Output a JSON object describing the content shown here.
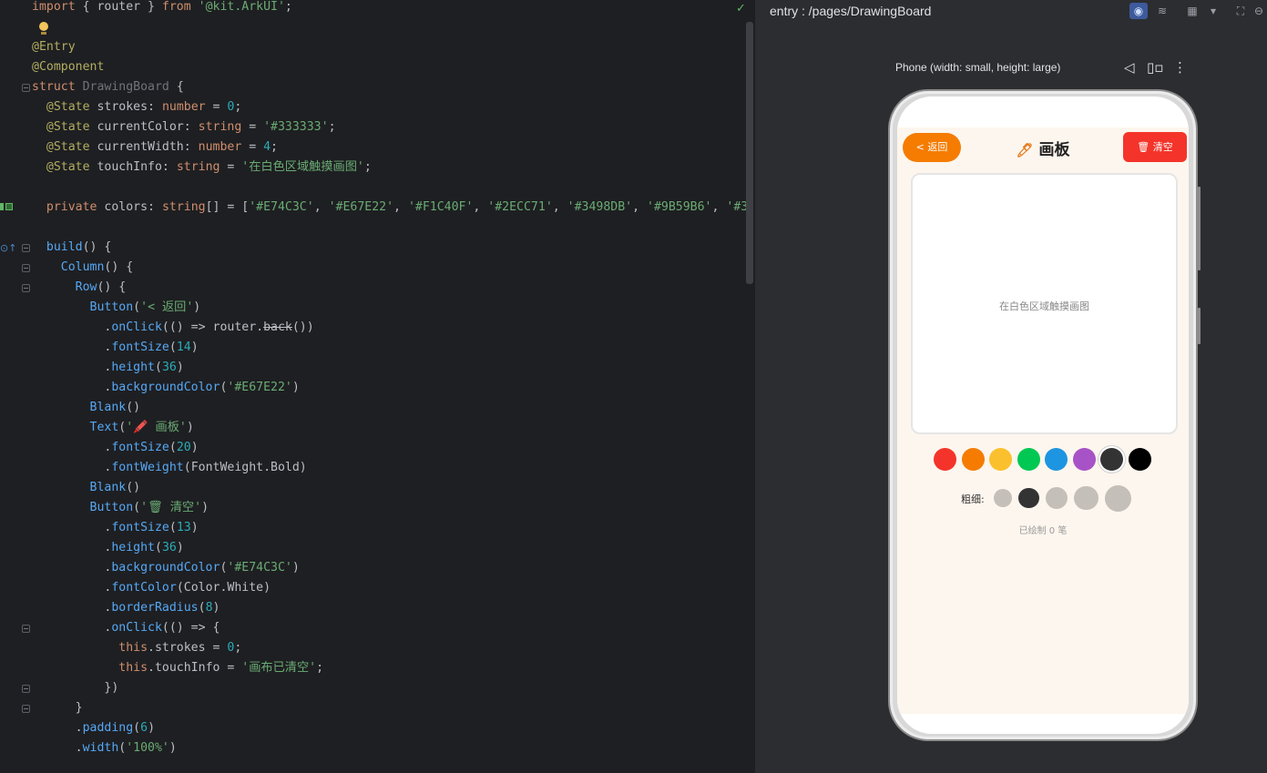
{
  "editor": {
    "status": "✓",
    "lines": [
      [
        [
          "kw",
          "import"
        ],
        [
          "",
          " { router } "
        ],
        [
          "kw",
          "from"
        ],
        [
          "",
          " "
        ],
        [
          "str",
          "'@kit.ArkUI'"
        ],
        [
          "",
          ";"
        ]
      ],
      [],
      [
        [
          "ann",
          "@Entry"
        ]
      ],
      [
        [
          "ann",
          "@Component"
        ]
      ],
      [
        [
          "kw",
          "struct"
        ],
        [
          "",
          " "
        ],
        [
          "dim",
          "DrawingBoard"
        ],
        [
          "",
          " {"
        ]
      ],
      [
        [
          "",
          "  "
        ],
        [
          "ann",
          "@State"
        ],
        [
          "",
          " strokes: "
        ],
        [
          "typ",
          "number"
        ],
        [
          "",
          " = "
        ],
        [
          "num",
          "0"
        ],
        [
          "",
          ";"
        ]
      ],
      [
        [
          "",
          "  "
        ],
        [
          "ann",
          "@State"
        ],
        [
          "",
          " currentColor: "
        ],
        [
          "typ",
          "string"
        ],
        [
          "",
          " = "
        ],
        [
          "str",
          "'#333333'"
        ],
        [
          "",
          ";"
        ]
      ],
      [
        [
          "",
          "  "
        ],
        [
          "ann",
          "@State"
        ],
        [
          "",
          " currentWidth: "
        ],
        [
          "typ",
          "number"
        ],
        [
          "",
          " = "
        ],
        [
          "num",
          "4"
        ],
        [
          "",
          ";"
        ]
      ],
      [
        [
          "",
          "  "
        ],
        [
          "ann",
          "@State"
        ],
        [
          "",
          " touchInfo: "
        ],
        [
          "typ",
          "string"
        ],
        [
          "",
          " = "
        ],
        [
          "str",
          "'在白色区域触摸画图'"
        ],
        [
          "",
          ";"
        ]
      ],
      [],
      [
        [
          "",
          "  "
        ],
        [
          "kw",
          "private"
        ],
        [
          "",
          " colors: "
        ],
        [
          "typ",
          "string"
        ],
        [
          "",
          "[] = ["
        ],
        [
          "str",
          "'#E74C3C'"
        ],
        [
          "",
          ", "
        ],
        [
          "str",
          "'#E67E22'"
        ],
        [
          "",
          ", "
        ],
        [
          "str",
          "'#F1C40F'"
        ],
        [
          "",
          ", "
        ],
        [
          "str",
          "'#2ECC71'"
        ],
        [
          "",
          ", "
        ],
        [
          "str",
          "'#3498DB'"
        ],
        [
          "",
          ", "
        ],
        [
          "str",
          "'#9B59B6'"
        ],
        [
          "",
          ", "
        ],
        [
          "str",
          "'#3"
        ]
      ],
      [],
      [
        [
          "",
          "  "
        ],
        [
          "fn",
          "build"
        ],
        [
          "",
          "() {"
        ]
      ],
      [
        [
          "",
          "    "
        ],
        [
          "fn",
          "Column"
        ],
        [
          "",
          "() {"
        ]
      ],
      [
        [
          "",
          "      "
        ],
        [
          "fn",
          "Row"
        ],
        [
          "",
          "() {"
        ]
      ],
      [
        [
          "",
          "        "
        ],
        [
          "fn",
          "Button"
        ],
        [
          "",
          "("
        ],
        [
          "str",
          "'< 返回'"
        ],
        [
          "",
          ")"
        ]
      ],
      [
        [
          "",
          "          ."
        ],
        [
          "fn",
          "onClick"
        ],
        [
          "",
          "(() => router."
        ],
        [
          "strike",
          "back"
        ],
        [
          "",
          "())"
        ]
      ],
      [
        [
          "",
          "          ."
        ],
        [
          "fn",
          "fontSize"
        ],
        [
          "",
          "("
        ],
        [
          "num",
          "14"
        ],
        [
          "",
          ")"
        ]
      ],
      [
        [
          "",
          "          ."
        ],
        [
          "fn",
          "height"
        ],
        [
          "",
          "("
        ],
        [
          "num",
          "36"
        ],
        [
          "",
          ")"
        ]
      ],
      [
        [
          "",
          "          ."
        ],
        [
          "fn",
          "backgroundColor"
        ],
        [
          "",
          "("
        ],
        [
          "str",
          "'#E67E22'"
        ],
        [
          "",
          ")"
        ]
      ],
      [
        [
          "",
          "        "
        ],
        [
          "fn",
          "Blank"
        ],
        [
          "",
          "()"
        ]
      ],
      [
        [
          "",
          "        "
        ],
        [
          "fn",
          "Text"
        ],
        [
          "",
          "("
        ],
        [
          "str",
          "'🖍️ 画板'"
        ],
        [
          "",
          ")"
        ]
      ],
      [
        [
          "",
          "          ."
        ],
        [
          "fn",
          "fontSize"
        ],
        [
          "",
          "("
        ],
        [
          "num",
          "20"
        ],
        [
          "",
          ")"
        ]
      ],
      [
        [
          "",
          "          ."
        ],
        [
          "fn",
          "fontWeight"
        ],
        [
          "",
          "(FontWeight.Bold)"
        ]
      ],
      [
        [
          "",
          "        "
        ],
        [
          "fn",
          "Blank"
        ],
        [
          "",
          "()"
        ]
      ],
      [
        [
          "",
          "        "
        ],
        [
          "fn",
          "Button"
        ],
        [
          "",
          "("
        ],
        [
          "str",
          "'🗑 清空'"
        ],
        [
          "",
          ")"
        ]
      ],
      [
        [
          "",
          "          ."
        ],
        [
          "fn",
          "fontSize"
        ],
        [
          "",
          "("
        ],
        [
          "num",
          "13"
        ],
        [
          "",
          ")"
        ]
      ],
      [
        [
          "",
          "          ."
        ],
        [
          "fn",
          "height"
        ],
        [
          "",
          "("
        ],
        [
          "num",
          "36"
        ],
        [
          "",
          ")"
        ]
      ],
      [
        [
          "",
          "          ."
        ],
        [
          "fn",
          "backgroundColor"
        ],
        [
          "",
          "("
        ],
        [
          "str",
          "'#E74C3C'"
        ],
        [
          "",
          ")"
        ]
      ],
      [
        [
          "",
          "          ."
        ],
        [
          "fn",
          "fontColor"
        ],
        [
          "",
          "(Color.White)"
        ]
      ],
      [
        [
          "",
          "          ."
        ],
        [
          "fn",
          "borderRadius"
        ],
        [
          "",
          "("
        ],
        [
          "num",
          "8"
        ],
        [
          "",
          ")"
        ]
      ],
      [
        [
          "",
          "          ."
        ],
        [
          "fn",
          "onClick"
        ],
        [
          "",
          "(() => {"
        ]
      ],
      [
        [
          "",
          "            "
        ],
        [
          "kw",
          "this"
        ],
        [
          "",
          ".strokes = "
        ],
        [
          "num",
          "0"
        ],
        [
          "",
          ";"
        ]
      ],
      [
        [
          "",
          "            "
        ],
        [
          "kw",
          "this"
        ],
        [
          "",
          ".touchInfo = "
        ],
        [
          "str",
          "'画布已清空'"
        ],
        [
          "",
          ";"
        ]
      ],
      [
        [
          "",
          "          })"
        ]
      ],
      [
        [
          "",
          "      }"
        ]
      ],
      [
        [
          "",
          "      ."
        ],
        [
          "fn",
          "padding"
        ],
        [
          "",
          "("
        ],
        [
          "num",
          "6"
        ],
        [
          "",
          ")"
        ]
      ],
      [
        [
          "",
          "      ."
        ],
        [
          "fn",
          "width"
        ],
        [
          "",
          "("
        ],
        [
          "str",
          "'100%'"
        ],
        [
          "",
          ")"
        ]
      ]
    ]
  },
  "preview": {
    "entry": "entry : /pages/DrawingBoard",
    "device_label": "Phone (width: small, height: large)",
    "toolbar_icons": [
      "eye-icon",
      "layers-icon",
      "grid-icon",
      "dropdown-icon",
      "frame-icon",
      "zoom-out-icon"
    ],
    "app": {
      "back_label": "< 返回",
      "title_icon": "🖊",
      "title": "画板",
      "clear_label": "🗑 清空",
      "canvas_hint": "在白色区域触摸画图",
      "colors": [
        "#f4342a",
        "#f57c00",
        "#fbc02d",
        "#00c853",
        "#1e95e0",
        "#a752c6",
        "#333333",
        "#000000"
      ],
      "selected_color": "#333333",
      "width_label": "粗细:",
      "widths": [
        2,
        4,
        6,
        8,
        10
      ],
      "selected_width": 4,
      "stroke_count": "已绘制 0 笔"
    }
  }
}
